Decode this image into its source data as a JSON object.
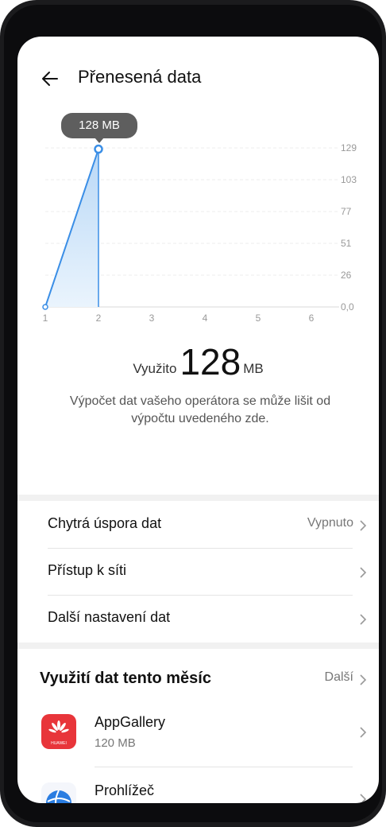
{
  "header": {
    "title": "Přenesená data"
  },
  "chart_data": {
    "type": "line",
    "x": [
      1,
      2
    ],
    "values": [
      0,
      128
    ],
    "x_ticks": [
      "1",
      "2",
      "3",
      "4",
      "5",
      "6"
    ],
    "y_ticks": [
      "129",
      "103",
      "77",
      "51",
      "26",
      "0,0"
    ],
    "ylim": [
      0,
      129
    ],
    "xlim": [
      1,
      6
    ],
    "tooltip": "128 MB",
    "grid": true,
    "color": "#3a8ee6"
  },
  "usage": {
    "label": "Využito",
    "value": "128",
    "unit": "MB"
  },
  "note": "Výpočet dat vašeho operátora se může lišit od výpočtu uvedeného zde.",
  "settings": {
    "smart_saver": {
      "label": "Chytrá úspora dat",
      "value": "Vypnuto"
    },
    "network_access": {
      "label": "Přístup k síti"
    },
    "more_settings": {
      "label": "Další nastavení dat"
    }
  },
  "monthly": {
    "title": "Využití dat tento měsíc",
    "more": "Další",
    "apps": [
      {
        "name": "AppGallery",
        "size": "120 MB",
        "icon": "huawei-appgallery-icon",
        "icon_text": "HUAWEI"
      },
      {
        "name": "Prohlížeč",
        "size": "",
        "icon": "browser-icon"
      }
    ]
  }
}
